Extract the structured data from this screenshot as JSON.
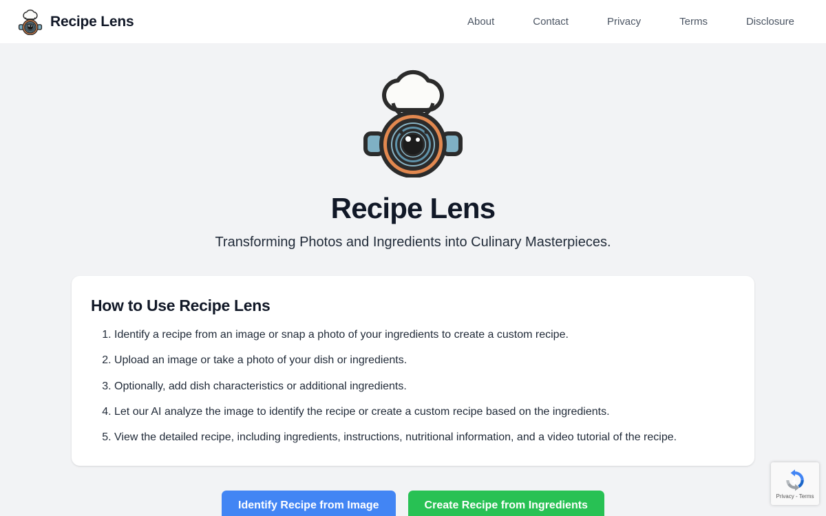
{
  "header": {
    "brand_name": "Recipe Lens",
    "logo_icon": "chef-camera-lens-logo",
    "nav": [
      {
        "label": "About"
      },
      {
        "label": "Contact"
      },
      {
        "label": "Privacy"
      },
      {
        "label": "Terms"
      },
      {
        "label": "Disclosure"
      }
    ]
  },
  "hero": {
    "logo_icon": "chef-camera-lens-logo",
    "title": "Recipe Lens",
    "subtitle": "Transforming Photos and Ingredients into Culinary Masterpieces."
  },
  "howto": {
    "heading": "How to Use Recipe Lens",
    "steps": [
      "Identify a recipe from an image or snap a photo of your ingredients to create a custom recipe.",
      "Upload an image or take a photo of your dish or ingredients.",
      "Optionally, add dish characteristics or additional ingredients.",
      "Let our AI analyze the image to identify the recipe or create a custom recipe based on the ingredients.",
      "View the detailed recipe, including ingredients, instructions, nutritional information, and a video tutorial of the recipe."
    ]
  },
  "actions": {
    "identify_label": "Identify Recipe from Image",
    "create_label": "Create Recipe from Ingredients"
  },
  "recaptcha": {
    "icon": "recaptcha-icon",
    "text": "Privacy - Terms"
  },
  "colors": {
    "page_background": "#f2f3f5",
    "header_background": "#ffffff",
    "card_background": "#ffffff",
    "identify_button": "#4285f4",
    "create_button": "#28c154",
    "logo_ring_orange": "#e2884f",
    "logo_lens_blue": "#6ea7bc",
    "text_primary": "#111827",
    "nav_link": "#4b5563"
  }
}
